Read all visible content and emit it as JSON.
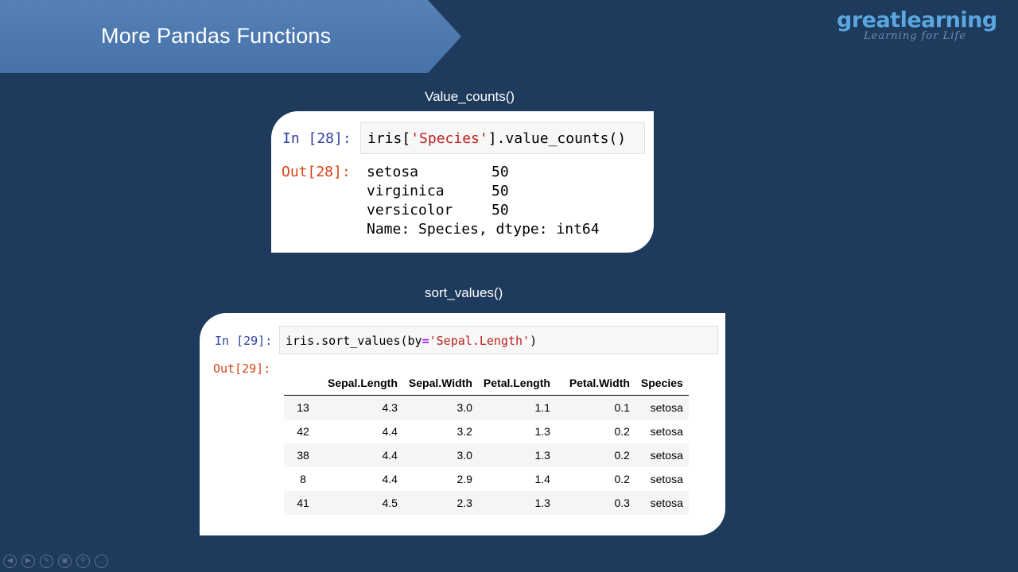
{
  "slide": {
    "title": "More Pandas Functions",
    "logo": {
      "name": "greatlearning",
      "tagline": "Learning for Life"
    }
  },
  "section1": {
    "heading": "Value_counts()",
    "in_prompt": "In [28]:",
    "out_prompt": "Out[28]:",
    "code": {
      "before": "iris[",
      "string": "'Species'",
      "after": "].value_counts()"
    },
    "output_lines": [
      {
        "label": "setosa",
        "value": "50"
      },
      {
        "label": "virginica",
        "value": "50"
      },
      {
        "label": "versicolor",
        "value": "50"
      }
    ],
    "footer": "Name: Species, dtype: int64"
  },
  "section2": {
    "heading": "sort_values()",
    "in_prompt": "In [29]:",
    "out_prompt": "Out[29]:",
    "code": {
      "before": "iris.sort_values(by",
      "eq": "=",
      "string": "'Sepal.Length'",
      "after": ")"
    },
    "table": {
      "columns": [
        "",
        "Sepal.Length",
        "Sepal.Width",
        "Petal.Length",
        "Petal.Width",
        "Species"
      ],
      "rows": [
        [
          "13",
          "4.3",
          "3.0",
          "1.1",
          "0.1",
          "setosa"
        ],
        [
          "42",
          "4.4",
          "3.2",
          "1.3",
          "0.2",
          "setosa"
        ],
        [
          "38",
          "4.4",
          "3.0",
          "1.3",
          "0.2",
          "setosa"
        ],
        [
          "8",
          "4.4",
          "2.9",
          "1.4",
          "0.2",
          "setosa"
        ],
        [
          "41",
          "4.5",
          "2.3",
          "1.3",
          "0.3",
          "setosa"
        ]
      ]
    }
  },
  "nav": {
    "icons": [
      "prev-icon",
      "next-icon",
      "pen-icon",
      "slides-icon",
      "zoom-icon",
      "more-icon"
    ],
    "glyphs": [
      "◀",
      "▶",
      "✎",
      "▣",
      "⚲",
      "…"
    ]
  }
}
